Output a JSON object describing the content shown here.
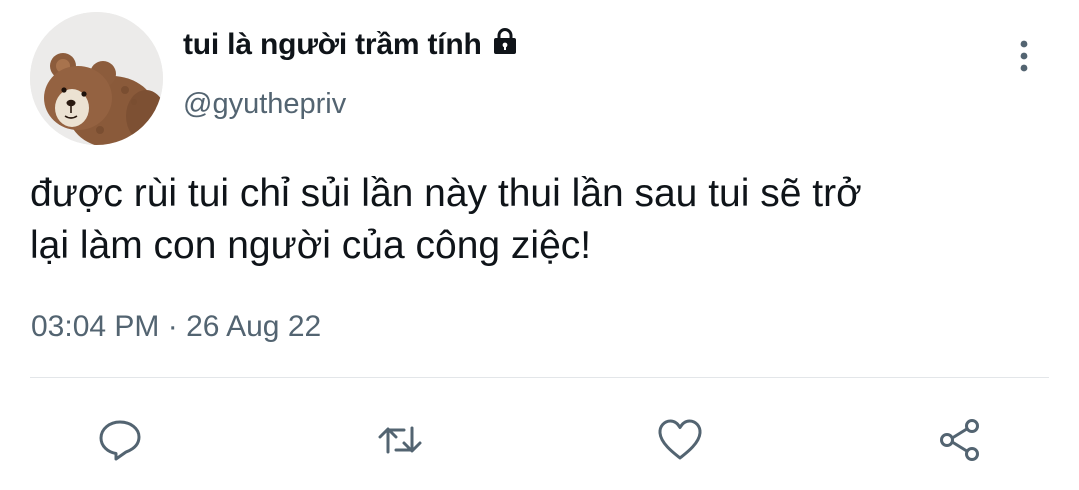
{
  "user": {
    "display_name": "tui là người trầm tính",
    "handle": "@gyuthepriv",
    "protected": true,
    "avatar": "teddy-bear-photo"
  },
  "tweet": {
    "text": "được rùi tui chỉ sủi lần này thui lần sau tui sẽ trở\nlại làm con người của công ziệc!",
    "timestamp": "03:04 PM · 26 Aug 22"
  },
  "actions": [
    {
      "name": "reply",
      "icon": "reply-icon"
    },
    {
      "name": "retweet",
      "icon": "retweet-icon"
    },
    {
      "name": "like",
      "icon": "heart-icon"
    },
    {
      "name": "share",
      "icon": "share-icon"
    }
  ],
  "colors": {
    "text_primary": "#0f1419",
    "text_secondary": "#536471",
    "icon": "#536471",
    "divider": "#e3e6e9"
  }
}
